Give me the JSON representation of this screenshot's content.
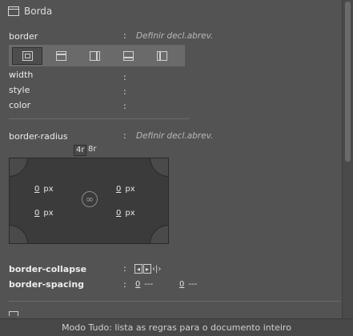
{
  "section": {
    "title": "Borda",
    "icon": "border-panel-icon"
  },
  "border": {
    "label": "border",
    "colon": ":",
    "value": "Definir decl.abrev."
  },
  "border_tabs": [
    {
      "name": "all-borders-icon"
    },
    {
      "name": "border-top-icon"
    },
    {
      "name": "border-right-icon"
    },
    {
      "name": "border-bottom-icon"
    },
    {
      "name": "border-left-icon"
    }
  ],
  "props": [
    {
      "label": "width",
      "colon": ":"
    },
    {
      "label": "style",
      "colon": ":"
    },
    {
      "label": "color",
      "colon": ":"
    }
  ],
  "border_radius": {
    "label": "border-radius",
    "colon": ":",
    "value": "Definir decl.abrev.",
    "mode_4r": "4r",
    "mode_8r": "8r",
    "top_left": {
      "value": "0",
      "unit": "px"
    },
    "top_right": {
      "value": "0",
      "unit": "px"
    },
    "bottom_left": {
      "value": "0",
      "unit": "px"
    },
    "bottom_right": {
      "value": "0",
      "unit": "px"
    }
  },
  "border_collapse": {
    "label": "border-collapse",
    "colon": ":"
  },
  "border_spacing": {
    "label": "border-spacing",
    "colon": ":",
    "value1": "0",
    "value1_dash": "---",
    "value2": "0",
    "value2_dash": "---"
  },
  "status_bar": {
    "text": "Modo Tudo: lista as regras para o documento inteiro"
  }
}
